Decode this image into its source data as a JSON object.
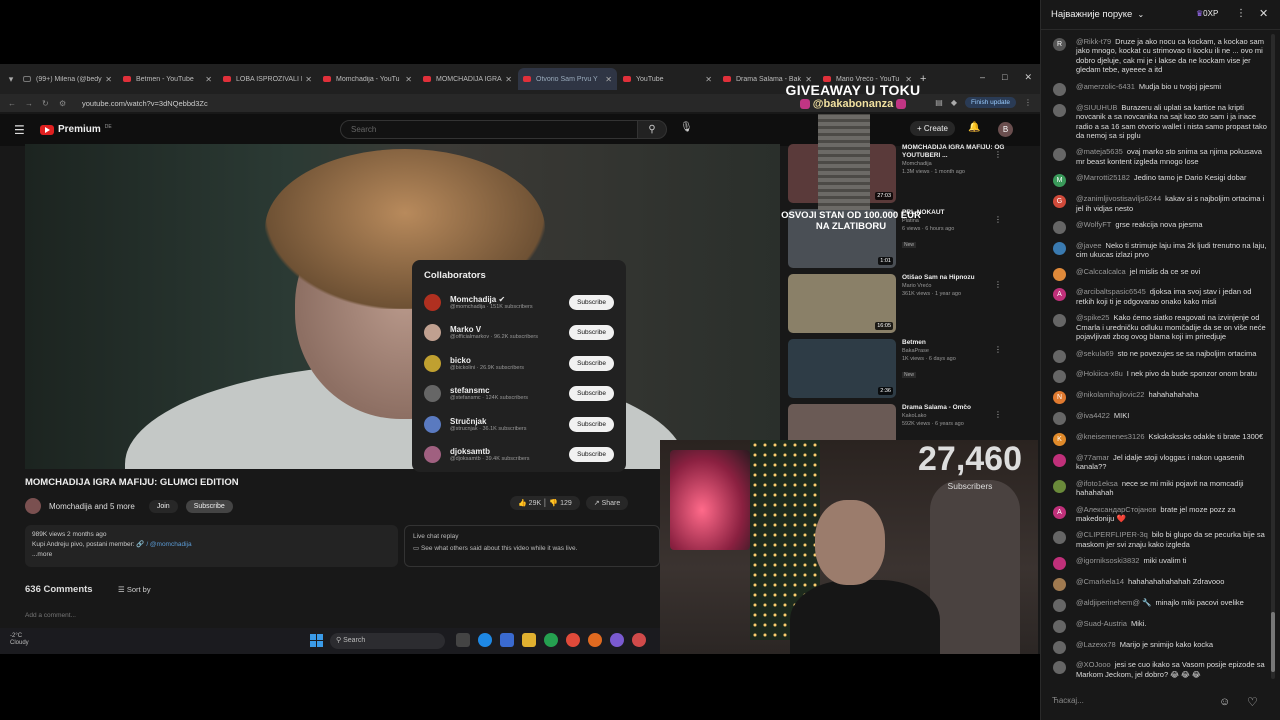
{
  "browser": {
    "tabs": [
      {
        "label": "(99+) Milena (@bedyn",
        "kind": "tt"
      },
      {
        "label": "Betmen - YouTube",
        "kind": "yt"
      },
      {
        "label": "LOBA ISPROZIVALI K",
        "kind": "yt"
      },
      {
        "label": "Momchadija - YouTu",
        "kind": "yt"
      },
      {
        "label": "MOMCHADIJA IGRA",
        "kind": "yt"
      },
      {
        "label": "Otvorio Sam Prvu Y",
        "kind": "yt",
        "active": true
      },
      {
        "label": "YouTube",
        "kind": "yt"
      },
      {
        "label": "Drama Salama - Bak",
        "kind": "yt"
      },
      {
        "label": "Mario Vrećo - YouTu",
        "kind": "yt"
      }
    ],
    "url": "youtube.com/watch?v=3dNQebbd3Zc",
    "finish_update": "Finish update"
  },
  "youtube": {
    "logo_text": "Premium",
    "logo_sup": "DE",
    "search_placeholder": "Search",
    "create_label": "Create",
    "avatar_letter": "B",
    "video_title": "MOMCHADIJA IGRA MAFIJU: GLUMCI EDITION",
    "channel": "Momchadija",
    "and_more": "and 5 more",
    "join": "Join",
    "subscribe": "Subscribe",
    "likes": "29K",
    "dislikes": "129",
    "share": "Share",
    "desc_stats": "989K views  2 months ago",
    "desc_line_prefix": "Kupi Andreju pivo, postani member: ",
    "desc_link": "🔗 / @momchadija",
    "desc_more": "...more",
    "replay_title": "Live chat replay",
    "replay_text": "See what others said about this video while it was live.",
    "comments_count": "636 Comments",
    "sort_by": "Sort by",
    "add_comment": "Add a comment...",
    "collab_title": "Collaborators",
    "collaborators": [
      {
        "name": "Momchadija ✔",
        "sub": "@momchadija · 151K subscribers",
        "btn": "Subscribe",
        "color": "#b03020"
      },
      {
        "name": "Marko V",
        "sub": "@officialmarkov · 96.2K subscribers",
        "btn": "Subscribe",
        "color": "#c0a090"
      },
      {
        "name": "bicko",
        "sub": "@bickolini · 26.9K subscribers",
        "btn": "Subscribe",
        "color": "#c0a030"
      },
      {
        "name": "stefansmc",
        "sub": "@stefansmc · 124K subscribers",
        "btn": "Subscribe",
        "color": "#666666"
      },
      {
        "name": "Stručnjak",
        "sub": "@strucnjak · 36.1K subscribers",
        "btn": "Subscribe",
        "color": "#5a7ac0"
      },
      {
        "name": "djoksamtb",
        "sub": "@djoksamtb · 39.4K subscribers",
        "btn": "Subscribe",
        "color": "#a06080"
      }
    ],
    "related": [
      {
        "title": "MOMCHADIJA IGRA MAFIJU: OG YOUTUBERI ...",
        "channel": "Momchadija",
        "meta": "1.3M views · 1 month ago",
        "dur": "27:03",
        "thumb": "#5a3a3a",
        "new": ""
      },
      {
        "title": "PRL NOKAUT",
        "channel": "Platina",
        "meta": "6 views · 6 hours ago",
        "dur": "1:01",
        "thumb": "#4a4f55",
        "new": "New"
      },
      {
        "title": "Otišao Sam na Hipnozu",
        "channel": "Mario Vrećo",
        "meta": "361K views · 1 year ago",
        "dur": "16:05",
        "thumb": "#8a8068",
        "new": ""
      },
      {
        "title": "Betmen",
        "channel": "BakaPrase",
        "meta": "1K views · 6 days ago",
        "dur": "2:36",
        "thumb": "#2e3c46",
        "new": "New"
      },
      {
        "title": "Drama Salama - Omčo",
        "channel": "KakoLako",
        "meta": "592K views · 6 years ago",
        "dur": "",
        "thumb": "#6a5a55",
        "new": ""
      }
    ]
  },
  "taskbar": {
    "temp": "-2°C",
    "weather": "Cloudy",
    "search": "Search"
  },
  "overlay": {
    "giveaway": "GIVEAWAY U TOKU",
    "handle": "@bakabonanza",
    "stan_line1": "OSVOJI STAN OD 100.000 EUR",
    "stan_line2": "NA ZLATIBORU",
    "subs_number": "27,460",
    "subs_label": "Subscribers"
  },
  "chat": {
    "title": "Најважније поруке",
    "xp": "0XP",
    "input_placeholder": "Ћаскај...",
    "messages": [
      {
        "name": "@Rikk-t79",
        "text": "Druze ja ako nocu ca kockam, a kockao sam jako mnogo, kockat cu strimovao ti kocku ili ne ... ovo mi dobro djeluje, cak mi je i lakse da ne kockam vise jer gledam tebe, ayeeee a itd",
        "color": "#555555",
        "letter": "R"
      },
      {
        "name": "@amerzolic-6431",
        "text": "Mudja bio u tvojoj pjesmi",
        "color": "#666666",
        "letter": ""
      },
      {
        "name": "@SIUUHUB",
        "text": "Burazeru ali uplati sa kartice na kripti novcanik a sa novcanika na sajt kao sto sam i ja inace radio a sa 16 sam otvorio wallet i nista samo propast tako da nemoj sa si pglu",
        "color": "#666666",
        "letter": ""
      },
      {
        "name": "@mateja5635",
        "text": "ovaj marko sto snima sa njima pokusava mr beast kontent izgleda mnogo lose",
        "color": "#666666",
        "letter": ""
      },
      {
        "name": "@Marrotti25182",
        "text": "Jedino tamo je Dario Kesigi dobar",
        "color": "#3a9a5a",
        "letter": "M"
      },
      {
        "name": "@zanimljivostisaviljs6244",
        "text": "kakav si s najboljim ortacima i jel ih vidjas nesto",
        "color": "#d04a3a",
        "letter": "G"
      },
      {
        "name": "@WolfyFT",
        "text": "grse reakcija nova pjesma",
        "color": "#666666",
        "letter": ""
      },
      {
        "name": "@javee",
        "text": "Neko ti strimuje laju ima 2k ljudi trenutno na laju, cim ukucas izlazi prvo",
        "color": "#3a7ab0",
        "letter": ""
      },
      {
        "name": "@Calccalcalca",
        "text": "jel mislis da ce se ovi",
        "color": "#e08a3a",
        "letter": ""
      },
      {
        "name": "@arcibaltspasic6545",
        "text": "djoksa ima svoj stav i jedan od retkih koji ti je odgovarao onako kako misli",
        "color": "#c0307a",
        "letter": "A"
      },
      {
        "name": "@spike25",
        "text": "Kako ćemo siatko reagovati na izvinjenje od Cmarla i uredničku odluku momčadije da se on više neće pojavljivati zbog ovog blama koji im priredjuje",
        "color": "#666666",
        "letter": ""
      },
      {
        "name": "@sekula69",
        "text": "sto ne povezujes se sa najboljim ortacima",
        "color": "#666666",
        "letter": ""
      },
      {
        "name": "@Hokiica-x8u",
        "text": "I nek pivo da bude sponzor onom bratu",
        "color": "#666666",
        "letter": ""
      },
      {
        "name": "@nikolamihajlovic22",
        "text": "hahahahahaha",
        "color": "#e07a30",
        "letter": "N"
      },
      {
        "name": "@iva4422",
        "text": "MIKI",
        "color": "#666666",
        "letter": ""
      },
      {
        "name": "@kneisemenes3126",
        "text": "Kskskskssks odakle ti brate 1300€",
        "color": "#e08a2a",
        "letter": "K"
      },
      {
        "name": "@77amar",
        "text": "Jel idalje stoji vloggas i nakon ugasenih kanala??",
        "color": "#c0307a",
        "letter": ""
      },
      {
        "name": "@ifoto1eksa",
        "text": "nece se mi miki pojavit na momcadiji hahahahah",
        "color": "#6a8a3a",
        "letter": ""
      },
      {
        "name": "@АлександарСтојанов",
        "text": "brate jel moze pozz za makedoniju ❤️",
        "color": "#c0307a",
        "letter": "A"
      },
      {
        "name": "@CLIPERFLIPER-3q",
        "text": "bilo bi glupo da se pecurka bije sa maskom jer svi znaju kako izgleda",
        "color": "#666666",
        "letter": ""
      },
      {
        "name": "@igorniksoski3832",
        "text": "miki uvalim ti",
        "color": "#c0307a",
        "letter": ""
      },
      {
        "name": "@Cmarkela14",
        "text": "hahahahahahahah Zdravooo",
        "color": "#a07a50",
        "letter": ""
      },
      {
        "name": "@aldjiperinehem@ 🔧",
        "text": "minajlo miki pacovi ovelike",
        "color": "#666666",
        "letter": ""
      },
      {
        "name": "@Suad-Austria",
        "text": "Miki.",
        "color": "#666666",
        "letter": ""
      },
      {
        "name": "@Lazexx78",
        "text": "Marijo je snimijo kako kocka",
        "color": "#666666",
        "letter": ""
      },
      {
        "name": "@XOJooo",
        "text": "jesi se cuo ikako sa Vasom posije epizode sa Markom Jeckom, jel dobro? 😂 😂 😂",
        "color": "#666666",
        "letter": ""
      }
    ]
  }
}
